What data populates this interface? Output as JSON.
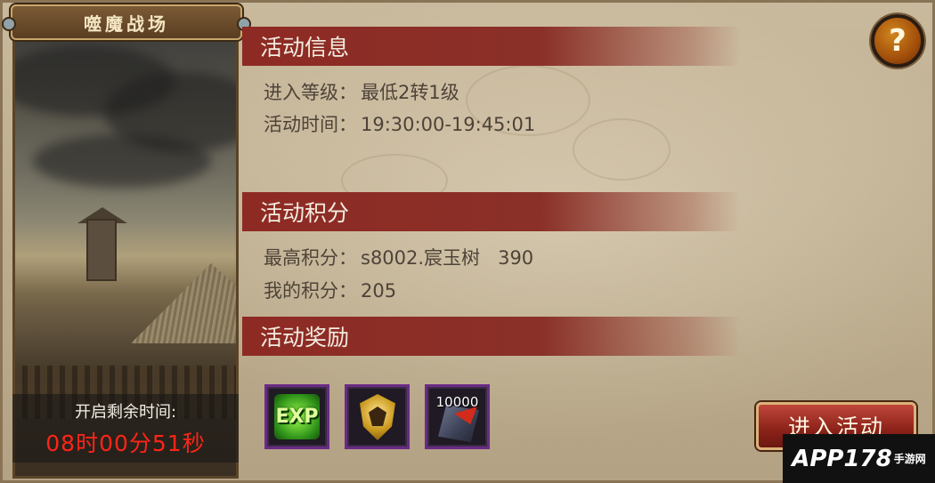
{
  "scene": {
    "title": "噬魔战场",
    "countdown_label": "开启剩余时间:",
    "countdown_value": "08时00分51秒"
  },
  "sections": {
    "info": {
      "header": "活动信息",
      "level_label": "进入等级：",
      "level_value": "最低2转1级",
      "time_label": "活动时间：",
      "time_value": "19:30:00-19:45:01"
    },
    "score": {
      "header": "活动积分",
      "top_label": "最高积分：",
      "top_value": "s8002.宸玉树   390",
      "mine_label": "我的积分：",
      "mine_value": "205"
    },
    "rewards": {
      "header": "活动奖励",
      "items": [
        {
          "icon": "exp-icon",
          "text": "EXP"
        },
        {
          "icon": "medal-icon",
          "text": ""
        },
        {
          "icon": "gem-icon",
          "qty": "10000"
        }
      ]
    }
  },
  "buttons": {
    "help": "?",
    "enter": "进入活动"
  },
  "watermark": {
    "brand": "APP178",
    "sub": "手游网"
  },
  "colors": {
    "header_red": "#8e2a24",
    "countdown_red": "#ff2418",
    "text_brown": "#4e4338",
    "reward_border": "#6a2b86"
  }
}
